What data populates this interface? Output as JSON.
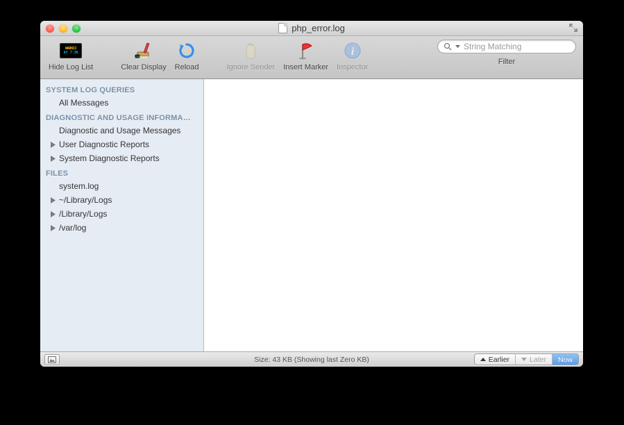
{
  "window": {
    "title": "php_error.log"
  },
  "toolbar": {
    "hide_log_list": "Hide Log List",
    "clear_display": "Clear Display",
    "reload": "Reload",
    "ignore_sender": "Ignore Sender",
    "insert_marker": "Insert Marker",
    "inspector": "Inspector",
    "filter_label": "Filter"
  },
  "search": {
    "placeholder": "String Matching"
  },
  "sidebar": {
    "sections": [
      {
        "header": "SYSTEM LOG QUERIES",
        "items": [
          {
            "label": "All Messages",
            "expandable": false
          }
        ]
      },
      {
        "header": "DIAGNOSTIC AND USAGE INFORMA…",
        "items": [
          {
            "label": "Diagnostic and Usage Messages",
            "expandable": false
          },
          {
            "label": "User Diagnostic Reports",
            "expandable": true
          },
          {
            "label": "System Diagnostic Reports",
            "expandable": true
          }
        ]
      },
      {
        "header": "FILES",
        "items": [
          {
            "label": "system.log",
            "expandable": false
          },
          {
            "label": "~/Library/Logs",
            "expandable": true
          },
          {
            "label": "/Library/Logs",
            "expandable": true
          },
          {
            "label": "/var/log",
            "expandable": true
          }
        ]
      }
    ]
  },
  "status": {
    "size_text": "Size: 43 KB (Showing last Zero KB)",
    "earlier": "Earlier",
    "later": "Later",
    "now": "Now"
  }
}
